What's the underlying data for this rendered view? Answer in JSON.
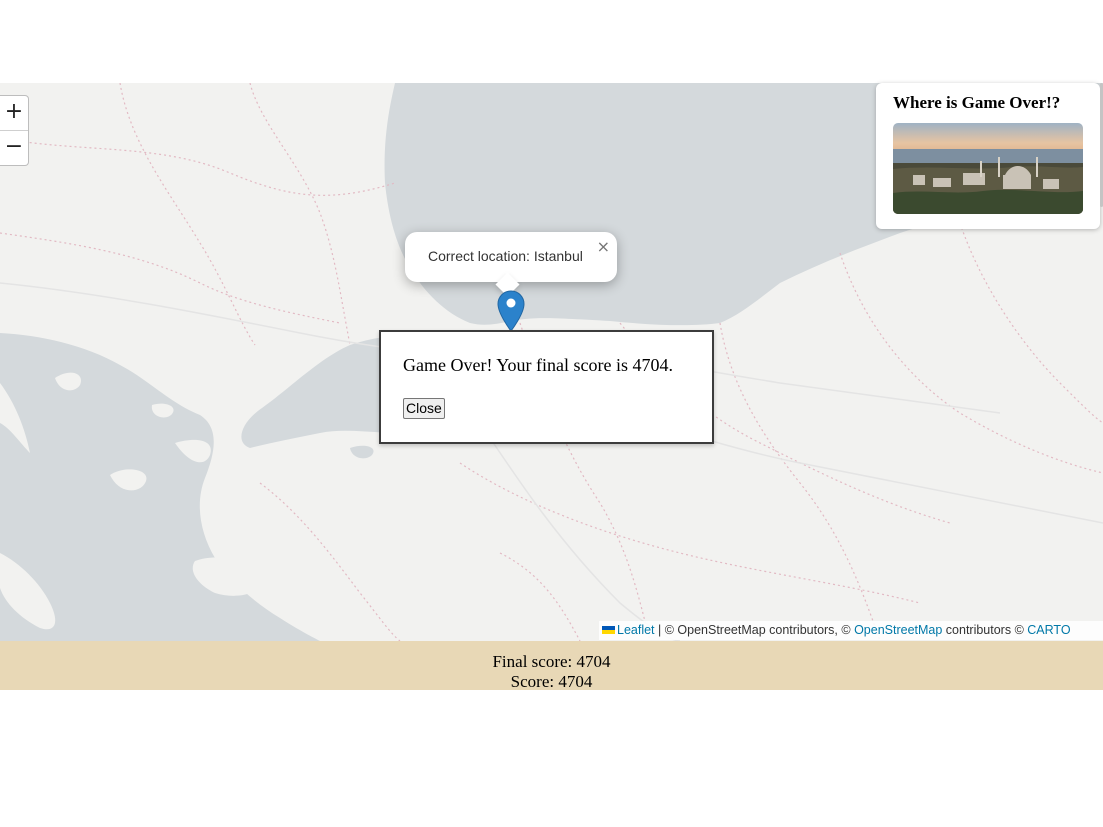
{
  "zoom": {
    "in_label": "+",
    "out_label": "−"
  },
  "panel": {
    "title": "Where is Game Over!?",
    "image": "istanbul-city-photo"
  },
  "popup": {
    "text": "Correct location: Istanbul",
    "close_label": "×"
  },
  "marker": {
    "icon": "map-pin-icon",
    "color": "#2b82cb"
  },
  "modal": {
    "message": "Game Over! Your final score is 4704.",
    "close_label": "Close"
  },
  "attribution": {
    "leaflet_link": "Leaflet",
    "sep": " | © OpenStreetMap contributors, © ",
    "osm_link": "OpenStreetMap",
    "mid": " contributors © ",
    "carto_link": "CARTO"
  },
  "footer": {
    "final_score": "Final score: 4704",
    "score": "Score: 4704"
  },
  "colors": {
    "water": "#d4d9dc",
    "land": "#f2f2f0",
    "footer_bg": "#e8d8b6",
    "link": "#0078a8",
    "marker": "#2b82cb"
  }
}
